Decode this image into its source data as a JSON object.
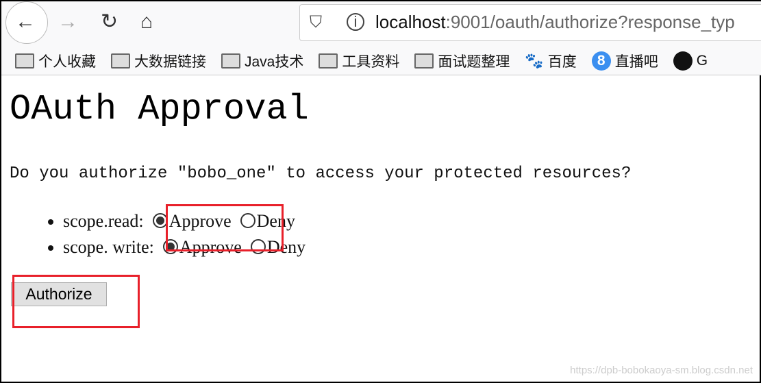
{
  "browser": {
    "url_host": "localhost",
    "url_rest": ":9001/oauth/authorize?response_typ",
    "bookmarks": [
      {
        "label": "个人收藏",
        "icon": "folder-icon"
      },
      {
        "label": "大数据链接",
        "icon": "folder-icon"
      },
      {
        "label": "Java技术",
        "icon": "folder-icon"
      },
      {
        "label": "工具资料",
        "icon": "folder-icon"
      },
      {
        "label": "面试题整理",
        "icon": "folder-icon"
      },
      {
        "label": "百度",
        "icon": "baidu-icon"
      },
      {
        "label": "直播吧",
        "icon": "zhibo8-icon"
      },
      {
        "label": "G",
        "icon": "github-icon"
      }
    ]
  },
  "page": {
    "title": "OAuth Approval",
    "question": "Do you authorize \"bobo_one\" to access your protected resources?",
    "scopes": [
      {
        "label": "scope.read: ",
        "approve": "Approve",
        "deny": "Deny",
        "selected": "Approve"
      },
      {
        "label": "scope. write: ",
        "approve": "Approve",
        "deny": "Deny",
        "selected": "Approve"
      }
    ],
    "authorize_label": "Authorize"
  },
  "annotation_color": "#e8202a",
  "watermark": "https://dpb-bobokaoya-sm.blog.csdn.net"
}
